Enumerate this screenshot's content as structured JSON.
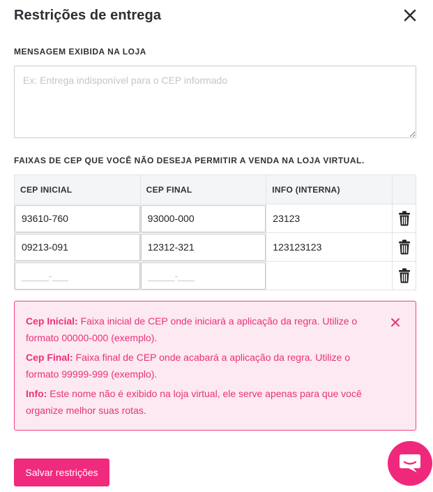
{
  "dialog": {
    "title": "Restrições de entrega"
  },
  "message_section": {
    "label": "MENSAGEM EXIBIDA NA LOJA",
    "placeholder": "Ex: Entrega indisponível para o CEP informado",
    "value": ""
  },
  "ranges_section": {
    "label": "FAIXAS DE CEP QUE VOCÊ NÃO DESEJA PERMITIR A VENDA NA LOJA VIRTUAL.",
    "columns": [
      "CEP INICIAL",
      "CEP FINAL",
      "INFO (INTERNA)"
    ],
    "rows": [
      {
        "cep_inicial": "93610-760",
        "cep_final": "93000-000",
        "info": "23123"
      },
      {
        "cep_inicial": "09213-091",
        "cep_final": "12312-321",
        "info": "123123123"
      },
      {
        "cep_inicial": "",
        "cep_final": "",
        "info": ""
      }
    ],
    "mask_placeholder": "_____-___"
  },
  "help": {
    "items": [
      {
        "term": "Cep Inicial:",
        "text": " Faixa inicial de CEP onde iniciará a aplicação da regra. Utilize o formato 00000-000 (exemplo)."
      },
      {
        "term": "Cep Final:",
        "text": " Faixa final de CEP onde acabará a aplicação da regra. Utilize o formato 99999-999 (exemplo)."
      },
      {
        "term": "Info:",
        "text": " Este nome não é exibido na loja virtual, ele serve apenas para que você organize melhor suas rotas."
      }
    ],
    "accent_color": "#e8317a"
  },
  "actions": {
    "save_label": "Salvar restrições"
  },
  "colors": {
    "brand": "#f02a7d",
    "alert_bg": "#fde9f1"
  }
}
